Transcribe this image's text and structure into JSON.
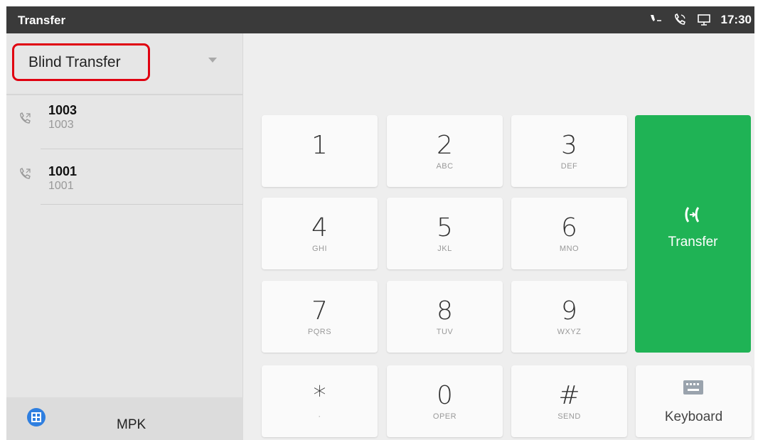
{
  "statusbar": {
    "title": "Transfer",
    "clock": "17:30"
  },
  "transfer_mode": {
    "selected": "Blind Transfer"
  },
  "calls": [
    {
      "name": "1003",
      "number": "1003"
    },
    {
      "name": "1001",
      "number": "1001"
    }
  ],
  "bottom": {
    "mpk_label": "MPK"
  },
  "keypad": [
    {
      "digit": "1",
      "sub": ""
    },
    {
      "digit": "2",
      "sub": "ABC"
    },
    {
      "digit": "3",
      "sub": "DEF"
    },
    {
      "digit": "4",
      "sub": "GHI"
    },
    {
      "digit": "5",
      "sub": "JKL"
    },
    {
      "digit": "6",
      "sub": "MNO"
    },
    {
      "digit": "7",
      "sub": "PQRS"
    },
    {
      "digit": "8",
      "sub": "TUV"
    },
    {
      "digit": "9",
      "sub": "WXYZ"
    },
    {
      "digit": "*",
      "sub": "·"
    },
    {
      "digit": "0",
      "sub": "OPER"
    },
    {
      "digit": "#",
      "sub": "SEND"
    }
  ],
  "actions": {
    "transfer_label": "Transfer",
    "keyboard_label": "Keyboard"
  },
  "colors": {
    "accent_green": "#1fb355",
    "highlight_red": "#e00010",
    "statusbar": "#3a3a3a",
    "mpk_blue": "#2f7fe0"
  }
}
